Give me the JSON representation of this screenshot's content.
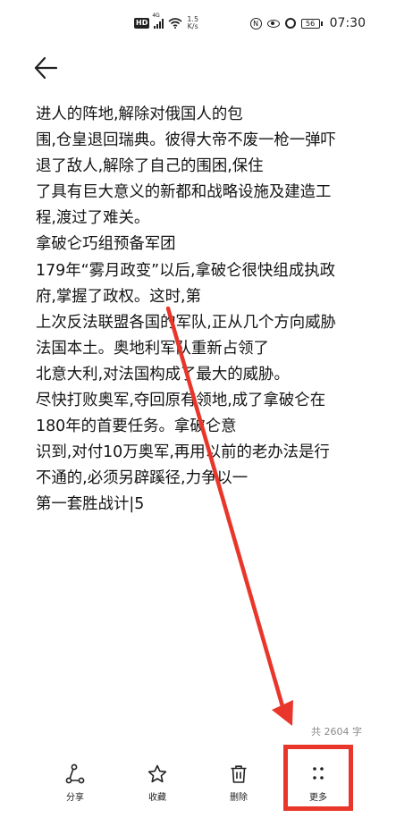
{
  "status_bar": {
    "hd": "HD",
    "network": "4G",
    "speed_value": "1.5",
    "speed_unit": "K/s",
    "battery": "56",
    "time": "07:30"
  },
  "article": {
    "lines": [
      "进人的阵地,解除对俄国人的包",
      "围,仓皇退回瑞典。彼得大帝不废一枪一弹吓",
      "退了敌人,解除了自己的围困,保住",
      "了具有巨大意义的新都和战略设施及建造工",
      "程,渡过了难关。",
      "拿破仑巧组预备军团",
      "179年“雾月政变”以后,拿破仑很快组成执政",
      "府,掌握了政权。这时,第",
      "上次反法联盟各国的军队,正从几个方向威胁",
      "法国本土。奥地利军队重新占领了",
      "北意大利,对法国构成了最大的威胁。",
      "尽快打败奥军,夺回原有领地,成了拿破仑在",
      "180年的首要任务。拿破仑意",
      "识到,对付10万奥军,再用以前的老办法是行",
      "不通的,必须另辟蹊径,力争以一",
      "第一套胜战计|5"
    ]
  },
  "word_count": "共 2604 字",
  "toolbar": {
    "share_label": "分享",
    "favorite_label": "收藏",
    "delete_label": "删除",
    "more_label": "更多"
  },
  "annotation_color": "#e8362b",
  "icons": [
    "back-arrow-icon",
    "share-icon",
    "star-icon",
    "trash-icon",
    "more-dots-icon"
  ]
}
